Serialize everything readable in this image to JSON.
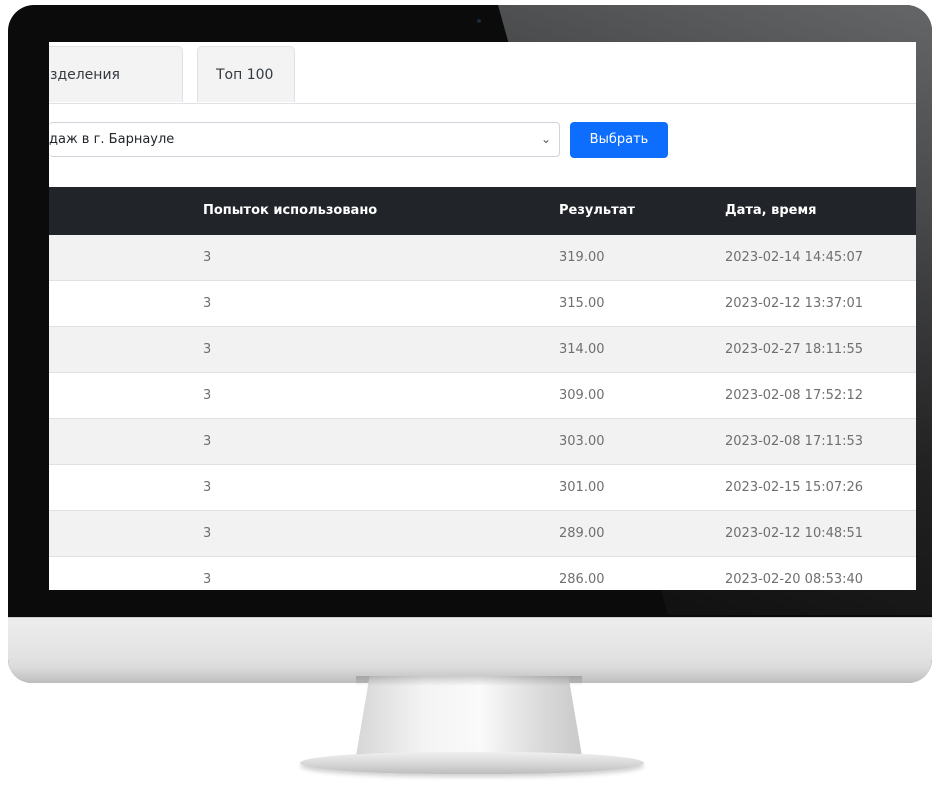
{
  "tabs": [
    {
      "label": "зделения"
    },
    {
      "label": "Топ 100"
    }
  ],
  "filter": {
    "select_value": "даж в г. Барнауле",
    "chevron": "chevron-down-icon",
    "button_label": "Выбрать",
    "button_color": "#0d6efd"
  },
  "table": {
    "headers": [
      "Попыток использовано",
      "Результат",
      "Дата, время"
    ],
    "rows": [
      {
        "attempts": "3",
        "result": "319.00",
        "datetime": "2023-02-14 14:45:07"
      },
      {
        "attempts": "3",
        "result": "315.00",
        "datetime": "2023-02-12 13:37:01"
      },
      {
        "attempts": "3",
        "result": "314.00",
        "datetime": "2023-02-27 18:11:55"
      },
      {
        "attempts": "3",
        "result": "309.00",
        "datetime": "2023-02-08 17:52:12"
      },
      {
        "attempts": "3",
        "result": "303.00",
        "datetime": "2023-02-08 17:11:53"
      },
      {
        "attempts": "3",
        "result": "301.00",
        "datetime": "2023-02-15 15:07:26"
      },
      {
        "attempts": "3",
        "result": "289.00",
        "datetime": "2023-02-12 10:48:51"
      },
      {
        "attempts": "3",
        "result": "286.00",
        "datetime": "2023-02-20 08:53:40"
      }
    ],
    "header_bg": "#212529",
    "stripe_color": "#f2f2f2"
  }
}
